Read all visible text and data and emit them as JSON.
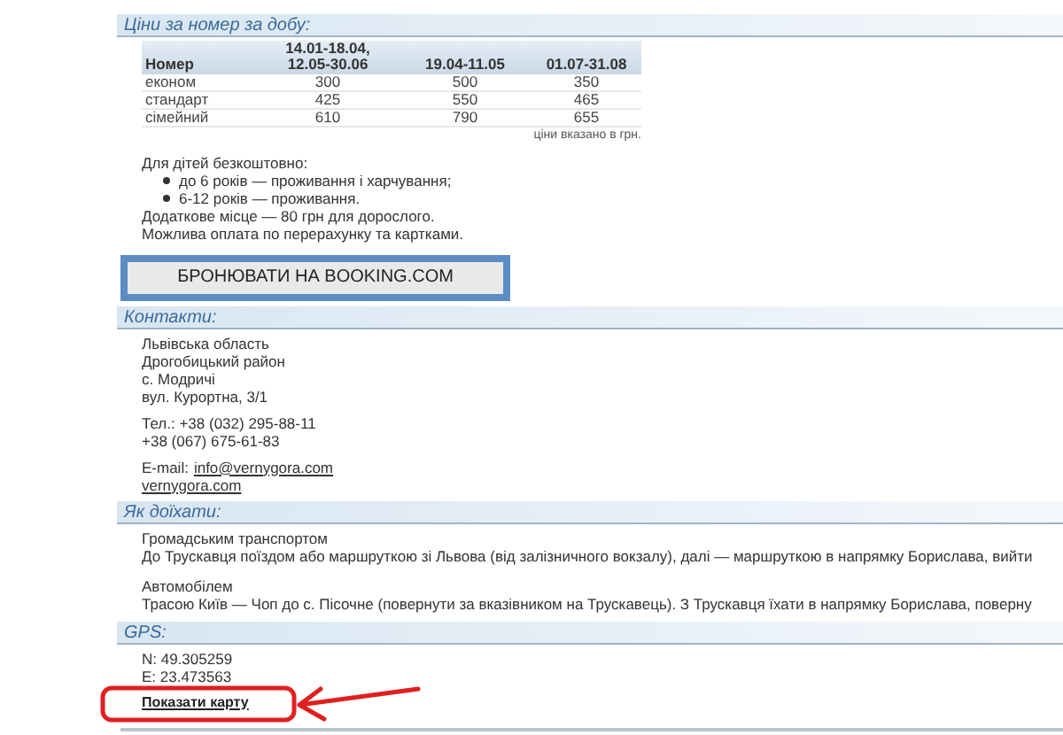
{
  "prices": {
    "title": "Ціни за номер за добу:",
    "columns": [
      "Номер",
      "14.01-18.04,\n12.05-30.06",
      "19.04-11.05",
      "01.07-31.08"
    ],
    "rows": [
      [
        "економ",
        "300",
        "500",
        "350"
      ],
      [
        "стандарт",
        "425",
        "550",
        "465"
      ],
      [
        "сімейний",
        "610",
        "790",
        "655"
      ]
    ],
    "note": "ціни вказано в грн.",
    "children_title": "Для дітей безкоштовно:",
    "children_items": [
      "до 6 років — проживання і харчування;",
      "6-12 років — проживання."
    ],
    "extra_lines": [
      "Додаткове місце — 80 грн для дорослого.",
      "Можлива оплата по перерахунку та картками."
    ],
    "booking_button": "БРОНЮВАТИ НА BOOKING.COM"
  },
  "contacts": {
    "title": "Контакти:",
    "address": [
      "Львівська область",
      "Дрогобицький район",
      "с. Модричі",
      "вул. Курортна, 3/1"
    ],
    "phones": [
      "Тел.: +38 (032) 295-88-11",
      "+38 (067) 675-61-83"
    ],
    "email_label": "E-mail:",
    "email": "info@vernygora.com",
    "website": "vernygora.com"
  },
  "directions": {
    "title": "Як доїхати:",
    "blocks": [
      {
        "heading": "Громадським транспортом",
        "text": "До Трускавця поїздом або маршруткою зі Львова (від залізничного вокзалу), далі — маршруткою в напрямку Борислава, вийти"
      },
      {
        "heading": "Автомобілем",
        "text": "Трасою Київ — Чоп до с. Пісочне (повернути за вказівником на Трускавець). З Трускавця їхати в напрямку Борислава, поверну"
      }
    ]
  },
  "gps": {
    "title": "GPS:",
    "lines": [
      "N: 49.305259",
      "E: 23.473563"
    ],
    "map_link": "Показати карту"
  }
}
